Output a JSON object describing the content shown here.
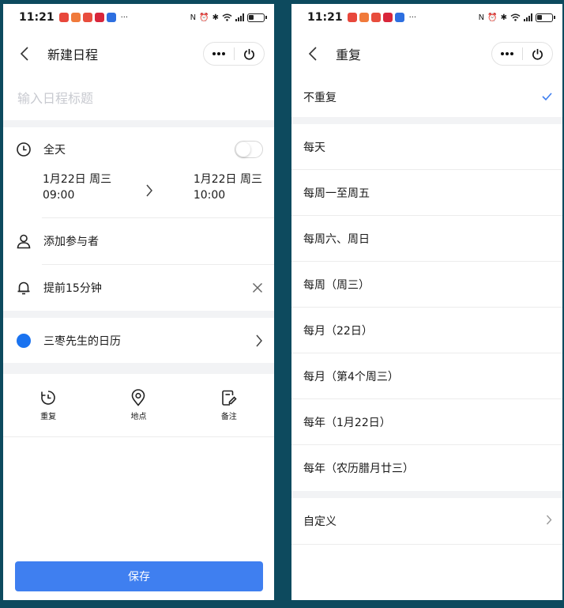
{
  "status": {
    "time": "11:21",
    "more": "···"
  },
  "left": {
    "nav_title": "新建日程",
    "title_placeholder": "输入日程标题",
    "all_day_label": "全天",
    "start_date": "1月22日 周三",
    "start_time": "09:00",
    "end_date": "1月22日 周三",
    "end_time": "10:00",
    "add_attendee_label": "添加参与者",
    "reminder_label": "提前15分钟",
    "calendar_label": "三枣先生的日历",
    "actions": [
      {
        "label": "重复"
      },
      {
        "label": "地点"
      },
      {
        "label": "备注"
      }
    ],
    "save_label": "保存"
  },
  "right": {
    "nav_title": "重复",
    "options": [
      "不重复",
      "每天",
      "每周一至周五",
      "每周六、周日",
      "每周（周三）",
      "每月（22日）",
      "每月（第4个周三）",
      "每年（1月22日）",
      "每年（农历腊月廿三）"
    ],
    "custom_label": "自定义"
  },
  "colors": {
    "accent": "#3f7ff0",
    "calendar_dot": "#1a73f0",
    "background": "#0d4a5e"
  }
}
